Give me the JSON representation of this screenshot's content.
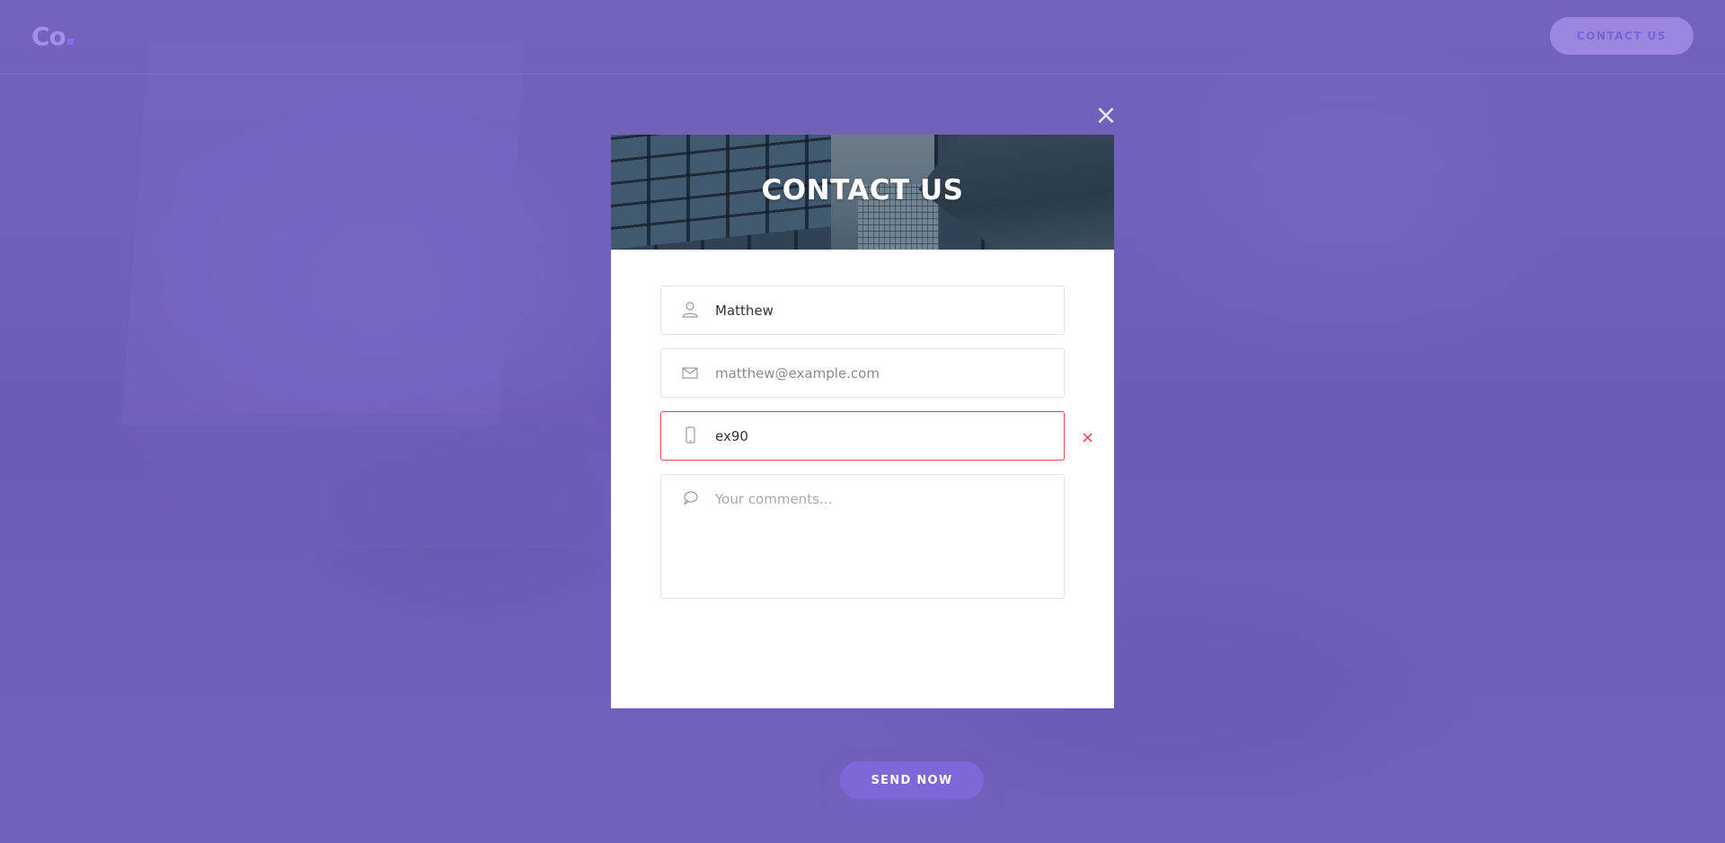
{
  "header": {
    "logo_text": "Co",
    "contact_button_label": "CONTACT US"
  },
  "modal": {
    "close_icon": "×",
    "title": "CONTACT US",
    "fields": {
      "name": {
        "value": "Matthew",
        "icon": "user-icon"
      },
      "email": {
        "value": "matthew@example.com",
        "icon": "envelope-icon"
      },
      "phone": {
        "value": "ex90",
        "icon": "mobile-phone-icon",
        "state": "error"
      },
      "comments": {
        "value": "",
        "placeholder": "Your comments...",
        "icon": "speech-bubble-icon"
      }
    },
    "error_icon": "×",
    "submit_label": "SEND NOW"
  },
  "colors": {
    "background": "#7260bb",
    "accent": "#7f67d8",
    "error": "#e8414d"
  }
}
